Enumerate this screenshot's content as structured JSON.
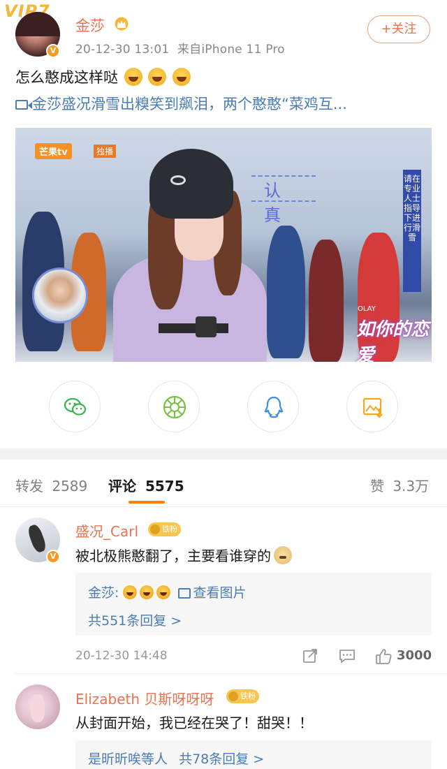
{
  "post": {
    "vip_label": "VIP7",
    "author": "金莎",
    "verified_badge": "V",
    "timestamp": "20-12-30 13:01",
    "source": "来自iPhone 11 Pro",
    "follow_label": "+关注",
    "text": "怎么憨成这样哒",
    "video_link": "金莎盛况滑雪出糗笑到飙泪，两个憨憨“菜鸡互...",
    "video": {
      "channel_logo": "芒果tv",
      "channel_tag": "独播",
      "caption_overlay": "认真",
      "side_caption": "请在专业人士指导下进行滑雪",
      "show_logo": "如你的恋爱",
      "sponsor": "OLAY"
    }
  },
  "share": {
    "icons": [
      "wechat-icon",
      "moments-icon",
      "qq-icon",
      "save-image-icon"
    ],
    "colors": {
      "wechat": "#3bb34a",
      "moments": "#7ac143",
      "qq": "#3b8fd9",
      "save": "#f5a623"
    }
  },
  "tabs": {
    "repost_label": "转发",
    "repost_count": "2589",
    "comment_label": "评论",
    "comment_count": "5575",
    "like_label": "赞",
    "like_count": "3.3万"
  },
  "comments": [
    {
      "name": "盛况_Carl",
      "fan_badge": "铁粉",
      "verified_badge": "V",
      "text": "被北极熊憨翻了，主要看谁穿的",
      "reply_author": "金莎:",
      "reply_image_label": "查看图片",
      "reply_count_text": "共551条回复 >",
      "time": "20-12-30 14:48",
      "likes": "3000"
    },
    {
      "name": "Elizabeth 贝斯呀呀呀",
      "fan_badge": "铁粉",
      "text": "从封面开始，我已经在哭了！甜哭！！",
      "reply_preview": "是昕昕唉等人",
      "reply_count_text": "共78条回复 >"
    }
  ],
  "accent": {
    "orange": "#ff8200",
    "name": "#eb7350",
    "link": "#4a7cb5"
  }
}
